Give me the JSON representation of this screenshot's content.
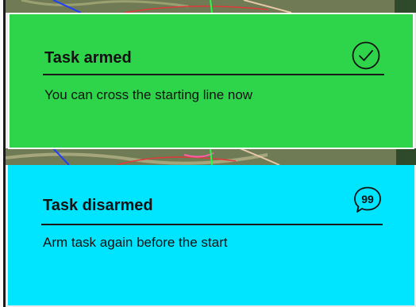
{
  "notifications": [
    {
      "title": "Task armed",
      "message": "You can cross the starting line now",
      "icon": "check-circle-icon",
      "color": "#2ed44a"
    },
    {
      "title": "Task disarmed",
      "message": "Arm task again before the start",
      "icon": "quote-bubble-icon",
      "color": "#00e5ff"
    }
  ],
  "colors": {
    "map_background": "#6f7b55",
    "frame": "#1b1b1b"
  }
}
